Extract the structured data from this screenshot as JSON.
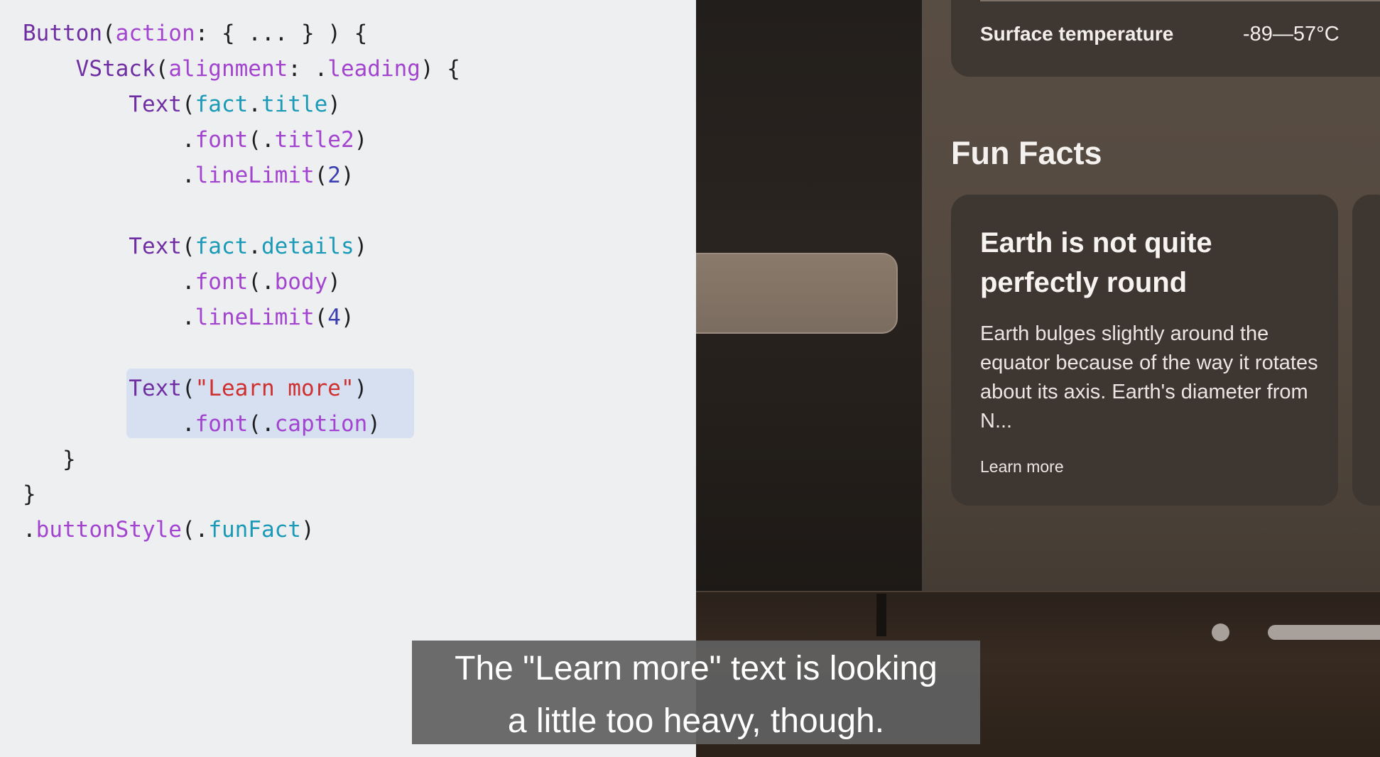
{
  "code": {
    "lines": [
      [
        {
          "t": "Button",
          "c": "kw"
        },
        {
          "t": "(",
          "c": "pun"
        },
        {
          "t": "action",
          "c": "lbl"
        },
        {
          "t": ": { ... } ) {",
          "c": "pun"
        }
      ],
      [
        {
          "t": "    VStack",
          "c": "kw"
        },
        {
          "t": "(",
          "c": "pun"
        },
        {
          "t": "alignment",
          "c": "lbl"
        },
        {
          "t": ": .",
          "c": "pun"
        },
        {
          "t": "leading",
          "c": "lbl"
        },
        {
          "t": ") {",
          "c": "pun"
        }
      ],
      [
        {
          "t": "        Text",
          "c": "kw"
        },
        {
          "t": "(",
          "c": "pun"
        },
        {
          "t": "fact",
          "c": "prop"
        },
        {
          "t": ".",
          "c": "pun"
        },
        {
          "t": "title",
          "c": "prop"
        },
        {
          "t": ")",
          "c": "pun"
        }
      ],
      [
        {
          "t": "            .",
          "c": "pun"
        },
        {
          "t": "font",
          "c": "lbl"
        },
        {
          "t": "(.",
          "c": "pun"
        },
        {
          "t": "title2",
          "c": "lbl"
        },
        {
          "t": ")",
          "c": "pun"
        }
      ],
      [
        {
          "t": "            .",
          "c": "pun"
        },
        {
          "t": "lineLimit",
          "c": "lbl"
        },
        {
          "t": "(",
          "c": "pun"
        },
        {
          "t": "2",
          "c": "num"
        },
        {
          "t": ")",
          "c": "pun"
        }
      ],
      [],
      [
        {
          "t": "        Text",
          "c": "kw"
        },
        {
          "t": "(",
          "c": "pun"
        },
        {
          "t": "fact",
          "c": "prop"
        },
        {
          "t": ".",
          "c": "pun"
        },
        {
          "t": "details",
          "c": "prop"
        },
        {
          "t": ")",
          "c": "pun"
        }
      ],
      [
        {
          "t": "            .",
          "c": "pun"
        },
        {
          "t": "font",
          "c": "lbl"
        },
        {
          "t": "(.",
          "c": "pun"
        },
        {
          "t": "body",
          "c": "lbl"
        },
        {
          "t": ")",
          "c": "pun"
        }
      ],
      [
        {
          "t": "            .",
          "c": "pun"
        },
        {
          "t": "lineLimit",
          "c": "lbl"
        },
        {
          "t": "(",
          "c": "pun"
        },
        {
          "t": "4",
          "c": "num"
        },
        {
          "t": ")",
          "c": "pun"
        }
      ],
      [],
      [
        {
          "t": "        Text",
          "c": "kw"
        },
        {
          "t": "(",
          "c": "pun"
        },
        {
          "t": "\"Learn more\"",
          "c": "str"
        },
        {
          "t": ")",
          "c": "pun"
        }
      ],
      [
        {
          "t": "            .",
          "c": "pun"
        },
        {
          "t": "font",
          "c": "lbl"
        },
        {
          "t": "(.",
          "c": "pun"
        },
        {
          "t": "caption",
          "c": "lbl"
        },
        {
          "t": ")",
          "c": "pun"
        }
      ],
      [
        {
          "t": "   }",
          "c": "pun"
        }
      ],
      [
        {
          "t": "}",
          "c": "pun"
        }
      ],
      [
        {
          "t": ".",
          "c": "pun"
        },
        {
          "t": "buttonStyle",
          "c": "lbl"
        },
        {
          "t": "(.",
          "c": "pun"
        },
        {
          "t": "funFact",
          "c": "prop"
        },
        {
          "t": ")",
          "c": "pun"
        }
      ]
    ]
  },
  "preview": {
    "temperature": {
      "label": "Surface temperature",
      "value": "-89—57°C"
    },
    "section_title": "Fun Facts",
    "fact": {
      "title": "Earth is not quite perfectly round",
      "details": "Earth bulges slightly around the equator because of the way it rotates about its axis. Earth's diameter from N...",
      "learn_more": "Learn more"
    }
  },
  "caption": {
    "line1": "The \"Learn more\" text is looking",
    "line2": "a little too heavy, though."
  }
}
